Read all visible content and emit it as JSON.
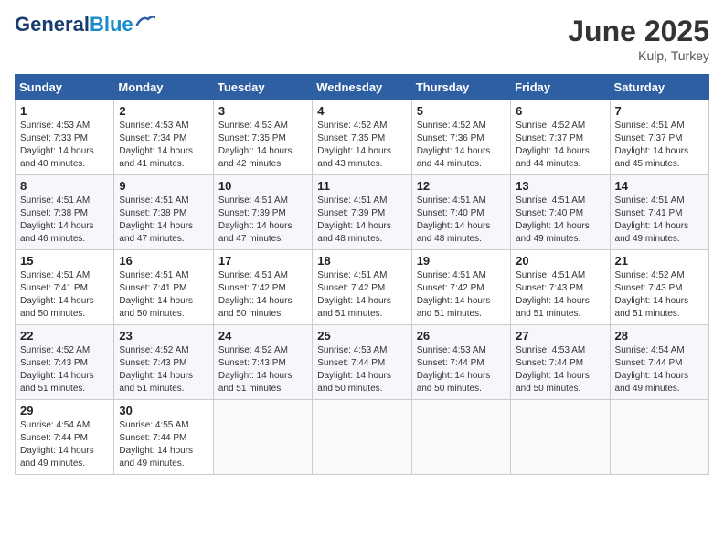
{
  "header": {
    "logo_general": "General",
    "logo_blue": "Blue",
    "month": "June 2025",
    "location": "Kulp, Turkey"
  },
  "weekdays": [
    "Sunday",
    "Monday",
    "Tuesday",
    "Wednesday",
    "Thursday",
    "Friday",
    "Saturday"
  ],
  "weeks": [
    [
      {
        "day": "1",
        "sunrise": "Sunrise: 4:53 AM",
        "sunset": "Sunset: 7:33 PM",
        "daylight": "Daylight: 14 hours and 40 minutes."
      },
      {
        "day": "2",
        "sunrise": "Sunrise: 4:53 AM",
        "sunset": "Sunset: 7:34 PM",
        "daylight": "Daylight: 14 hours and 41 minutes."
      },
      {
        "day": "3",
        "sunrise": "Sunrise: 4:53 AM",
        "sunset": "Sunset: 7:35 PM",
        "daylight": "Daylight: 14 hours and 42 minutes."
      },
      {
        "day": "4",
        "sunrise": "Sunrise: 4:52 AM",
        "sunset": "Sunset: 7:35 PM",
        "daylight": "Daylight: 14 hours and 43 minutes."
      },
      {
        "day": "5",
        "sunrise": "Sunrise: 4:52 AM",
        "sunset": "Sunset: 7:36 PM",
        "daylight": "Daylight: 14 hours and 44 minutes."
      },
      {
        "day": "6",
        "sunrise": "Sunrise: 4:52 AM",
        "sunset": "Sunset: 7:37 PM",
        "daylight": "Daylight: 14 hours and 44 minutes."
      },
      {
        "day": "7",
        "sunrise": "Sunrise: 4:51 AM",
        "sunset": "Sunset: 7:37 PM",
        "daylight": "Daylight: 14 hours and 45 minutes."
      }
    ],
    [
      {
        "day": "8",
        "sunrise": "Sunrise: 4:51 AM",
        "sunset": "Sunset: 7:38 PM",
        "daylight": "Daylight: 14 hours and 46 minutes."
      },
      {
        "day": "9",
        "sunrise": "Sunrise: 4:51 AM",
        "sunset": "Sunset: 7:38 PM",
        "daylight": "Daylight: 14 hours and 47 minutes."
      },
      {
        "day": "10",
        "sunrise": "Sunrise: 4:51 AM",
        "sunset": "Sunset: 7:39 PM",
        "daylight": "Daylight: 14 hours and 47 minutes."
      },
      {
        "day": "11",
        "sunrise": "Sunrise: 4:51 AM",
        "sunset": "Sunset: 7:39 PM",
        "daylight": "Daylight: 14 hours and 48 minutes."
      },
      {
        "day": "12",
        "sunrise": "Sunrise: 4:51 AM",
        "sunset": "Sunset: 7:40 PM",
        "daylight": "Daylight: 14 hours and 48 minutes."
      },
      {
        "day": "13",
        "sunrise": "Sunrise: 4:51 AM",
        "sunset": "Sunset: 7:40 PM",
        "daylight": "Daylight: 14 hours and 49 minutes."
      },
      {
        "day": "14",
        "sunrise": "Sunrise: 4:51 AM",
        "sunset": "Sunset: 7:41 PM",
        "daylight": "Daylight: 14 hours and 49 minutes."
      }
    ],
    [
      {
        "day": "15",
        "sunrise": "Sunrise: 4:51 AM",
        "sunset": "Sunset: 7:41 PM",
        "daylight": "Daylight: 14 hours and 50 minutes."
      },
      {
        "day": "16",
        "sunrise": "Sunrise: 4:51 AM",
        "sunset": "Sunset: 7:41 PM",
        "daylight": "Daylight: 14 hours and 50 minutes."
      },
      {
        "day": "17",
        "sunrise": "Sunrise: 4:51 AM",
        "sunset": "Sunset: 7:42 PM",
        "daylight": "Daylight: 14 hours and 50 minutes."
      },
      {
        "day": "18",
        "sunrise": "Sunrise: 4:51 AM",
        "sunset": "Sunset: 7:42 PM",
        "daylight": "Daylight: 14 hours and 51 minutes."
      },
      {
        "day": "19",
        "sunrise": "Sunrise: 4:51 AM",
        "sunset": "Sunset: 7:42 PM",
        "daylight": "Daylight: 14 hours and 51 minutes."
      },
      {
        "day": "20",
        "sunrise": "Sunrise: 4:51 AM",
        "sunset": "Sunset: 7:43 PM",
        "daylight": "Daylight: 14 hours and 51 minutes."
      },
      {
        "day": "21",
        "sunrise": "Sunrise: 4:52 AM",
        "sunset": "Sunset: 7:43 PM",
        "daylight": "Daylight: 14 hours and 51 minutes."
      }
    ],
    [
      {
        "day": "22",
        "sunrise": "Sunrise: 4:52 AM",
        "sunset": "Sunset: 7:43 PM",
        "daylight": "Daylight: 14 hours and 51 minutes."
      },
      {
        "day": "23",
        "sunrise": "Sunrise: 4:52 AM",
        "sunset": "Sunset: 7:43 PM",
        "daylight": "Daylight: 14 hours and 51 minutes."
      },
      {
        "day": "24",
        "sunrise": "Sunrise: 4:52 AM",
        "sunset": "Sunset: 7:43 PM",
        "daylight": "Daylight: 14 hours and 51 minutes."
      },
      {
        "day": "25",
        "sunrise": "Sunrise: 4:53 AM",
        "sunset": "Sunset: 7:44 PM",
        "daylight": "Daylight: 14 hours and 50 minutes."
      },
      {
        "day": "26",
        "sunrise": "Sunrise: 4:53 AM",
        "sunset": "Sunset: 7:44 PM",
        "daylight": "Daylight: 14 hours and 50 minutes."
      },
      {
        "day": "27",
        "sunrise": "Sunrise: 4:53 AM",
        "sunset": "Sunset: 7:44 PM",
        "daylight": "Daylight: 14 hours and 50 minutes."
      },
      {
        "day": "28",
        "sunrise": "Sunrise: 4:54 AM",
        "sunset": "Sunset: 7:44 PM",
        "daylight": "Daylight: 14 hours and 49 minutes."
      }
    ],
    [
      {
        "day": "29",
        "sunrise": "Sunrise: 4:54 AM",
        "sunset": "Sunset: 7:44 PM",
        "daylight": "Daylight: 14 hours and 49 minutes."
      },
      {
        "day": "30",
        "sunrise": "Sunrise: 4:55 AM",
        "sunset": "Sunset: 7:44 PM",
        "daylight": "Daylight: 14 hours and 49 minutes."
      },
      null,
      null,
      null,
      null,
      null
    ]
  ]
}
